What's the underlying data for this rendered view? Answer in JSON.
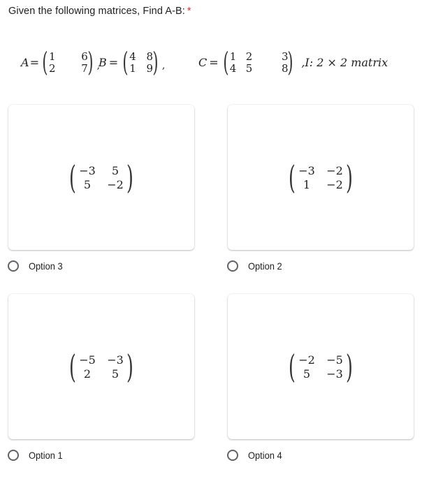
{
  "question": {
    "title": "Given the following matrices, Find A-B:",
    "required_marker": "*"
  },
  "matrices": {
    "A": {
      "label": "A",
      "eq": "=",
      "rows": [
        [
          "1",
          "6"
        ],
        [
          "2",
          "7"
        ]
      ]
    },
    "B": {
      "label": "B",
      "eq": "=",
      "rows": [
        [
          "4",
          "8"
        ],
        [
          "1",
          "9"
        ]
      ]
    },
    "C": {
      "label": "C",
      "eq": "=",
      "rows": [
        [
          "1",
          "2",
          "3"
        ],
        [
          "4",
          "5",
          "8"
        ]
      ]
    },
    "comma": ",",
    "identity_note": ",I: 2 × 2 matrix"
  },
  "options": [
    {
      "label": "Option 3",
      "matrix": [
        [
          "−3",
          "5"
        ],
        [
          "5",
          "−2"
        ]
      ],
      "selected": false
    },
    {
      "label": "Option 2",
      "matrix": [
        [
          "−3",
          "−2"
        ],
        [
          "1",
          "−2"
        ]
      ],
      "selected": false
    },
    {
      "label": "Option 1",
      "matrix": [
        [
          "−5",
          "−3"
        ],
        [
          "2",
          "5"
        ]
      ],
      "selected": false
    },
    {
      "label": "Option 4",
      "matrix": [
        [
          "−2",
          "−5"
        ],
        [
          "5",
          "−3"
        ]
      ],
      "selected": false
    }
  ],
  "colors": {
    "required": "#d93025",
    "radio_border": "#5f6368",
    "text": "#202124"
  }
}
